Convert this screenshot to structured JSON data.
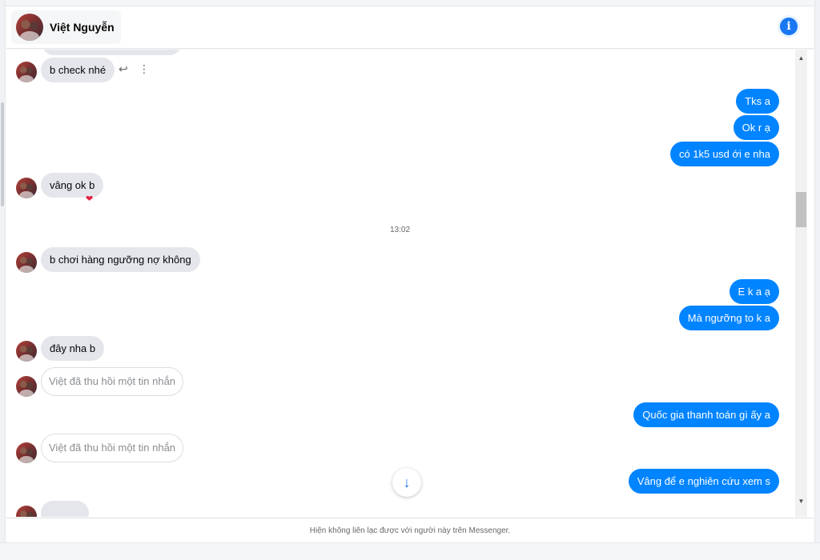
{
  "header": {
    "contact_name": "Việt Nguyễn",
    "info_icon": "i"
  },
  "thread": {
    "messages": [
      {
        "type": "incoming",
        "text": "b check nhé"
      },
      {
        "type": "outgoing",
        "text": "Tks a"
      },
      {
        "type": "outgoing",
        "text": "Ok r ạ"
      },
      {
        "type": "outgoing",
        "text": "có 1k5 usd ới e nha"
      },
      {
        "type": "incoming",
        "text": "vâng ok b",
        "reaction": "❤"
      },
      {
        "type": "timestamp",
        "text": "13:02"
      },
      {
        "type": "incoming",
        "text": "b chơi hàng ngưỡng nợ không"
      },
      {
        "type": "outgoing",
        "text": "E k a ạ"
      },
      {
        "type": "outgoing",
        "text": "Mà ngưỡng to k a"
      },
      {
        "type": "incoming",
        "text": "đây nha b"
      },
      {
        "type": "recalled",
        "text": "Việt đã thu hồi một tin nhắn"
      },
      {
        "type": "outgoing",
        "text": "Quốc gia thanh toán gì ấy a"
      },
      {
        "type": "recalled",
        "text": "Việt đã thu hồi một tin nhắn"
      },
      {
        "type": "outgoing",
        "text": "Vâng để e nghiên cứu xem s"
      }
    ],
    "message_actions": {
      "reply_icon": "↩",
      "more_icon": "⋮"
    },
    "scroll_down_icon": "↓"
  },
  "footer": {
    "notice": "Hiện không liên lạc được với người này trên Messenger."
  },
  "scrollbar": {
    "up_icon": "▲",
    "down_icon": "▼"
  },
  "colors": {
    "outgoing_bubble": "#0084ff",
    "incoming_bubble": "#e4e6eb",
    "accent": "#1877f2"
  }
}
